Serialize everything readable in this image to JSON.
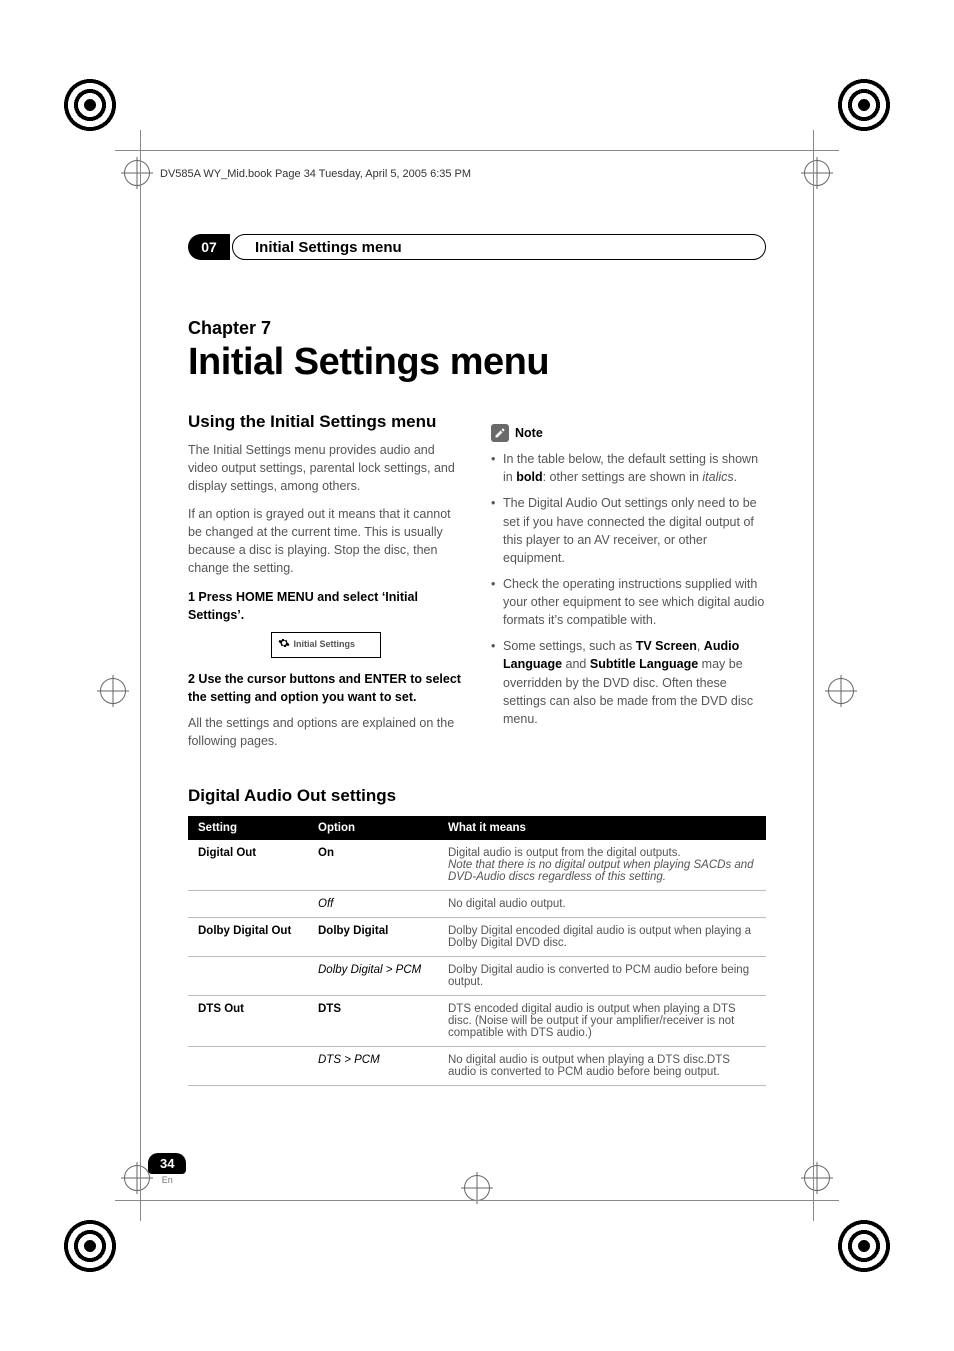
{
  "meta_line": "DV585A WY_Mid.book  Page 34  Tuesday, April 5, 2005  6:35 PM",
  "chapter_number_tab": "07",
  "chapter_tab_title": "Initial Settings menu",
  "chapter_label": "Chapter 7",
  "page_title": "Initial Settings menu",
  "left": {
    "heading": "Using the Initial Settings menu",
    "p1": "The Initial Settings menu provides audio and video output settings, parental lock settings, and display settings, among others.",
    "p2": "If an option is grayed out it means that it cannot be changed at the current time. This is usually because a disc is playing. Stop the disc, then change the setting.",
    "step1": "1    Press HOME MENU and select ‘Initial Settings’.",
    "button_label": "Initial Settings",
    "step2": "2    Use the cursor buttons and ENTER to select the setting and option you want to set.",
    "p3": "All the settings and options are explained on the following pages."
  },
  "right": {
    "note_label": "Note",
    "bullets": [
      {
        "pre": "In the table below, the default setting is shown in ",
        "bold": "bold",
        "mid": ": other settings are shown in ",
        "ital": "italics",
        "post": "."
      },
      {
        "text": "The Digital Audio Out settings only need to be set if you have connected the digital output of this player to an AV receiver, or other equipment."
      },
      {
        "text": "Check the operating instructions supplied with your other equipment to see which digital audio formats it’s compatible with."
      },
      {
        "pre": "Some settings, such as ",
        "b1": "TV Screen",
        "sep1": ", ",
        "b2": "Audio Language",
        "sep2": " and ",
        "b3": "Subtitle Language",
        "post": " may be overridden by the DVD disc. Often these settings can also be made from the DVD disc menu."
      }
    ]
  },
  "table_heading": "Digital Audio Out settings",
  "table": {
    "headers": [
      "Setting",
      "Option",
      "What it means"
    ],
    "rows": [
      {
        "setting": "Digital Out",
        "option": "On",
        "opt_style": "bold",
        "desc": "Digital audio is output from the digital outputs.",
        "desc_ital": "Note that there is no digital output when playing SACDs and DVD-Audio discs regardless of this setting."
      },
      {
        "setting": "",
        "option": "Off",
        "opt_style": "ital",
        "desc": "No digital audio output."
      },
      {
        "setting": "Dolby Digital Out",
        "option": "Dolby Digital",
        "opt_style": "bold",
        "desc": "Dolby Digital encoded digital audio is output when playing a Dolby Digital DVD disc."
      },
      {
        "setting": "",
        "option": "Dolby Digital > PCM",
        "opt_style": "ital",
        "desc": "Dolby Digital audio is converted to PCM audio before being output."
      },
      {
        "setting": "DTS Out",
        "option": "DTS",
        "opt_style": "bold",
        "desc": "DTS encoded digital audio is output when playing a DTS disc. (Noise will be output if your amplifier/receiver is not compatible with DTS audio.)"
      },
      {
        "setting": "",
        "option": "DTS > PCM",
        "opt_style": "ital",
        "desc": "No digital audio is output when playing a DTS disc.DTS audio is converted to PCM audio before being output."
      }
    ]
  },
  "page_number": "34",
  "page_lang": "En"
}
